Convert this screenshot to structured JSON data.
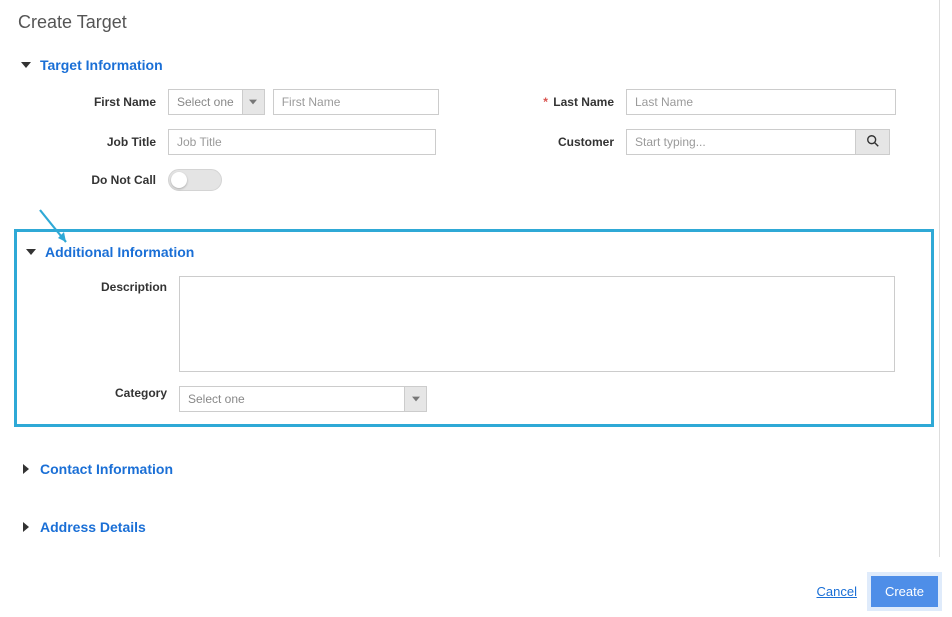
{
  "page": {
    "title": "Create Target"
  },
  "sections": {
    "target_info": {
      "title": "Target Information",
      "fields": {
        "first_name": {
          "label": "First Name",
          "select_placeholder": "Select one",
          "placeholder": "First Name"
        },
        "last_name": {
          "label": "Last Name",
          "placeholder": "Last Name",
          "required_mark": "*"
        },
        "job_title": {
          "label": "Job Title",
          "placeholder": "Job Title"
        },
        "customer": {
          "label": "Customer",
          "placeholder": "Start typing..."
        },
        "do_not_call": {
          "label": "Do Not Call"
        }
      }
    },
    "additional_info": {
      "title": "Additional Information",
      "fields": {
        "description": {
          "label": "Description"
        },
        "category": {
          "label": "Category",
          "select_placeholder": "Select one"
        }
      }
    },
    "contact_info": {
      "title": "Contact Information"
    },
    "address_details": {
      "title": "Address Details"
    }
  },
  "footer": {
    "cancel": "Cancel",
    "create": "Create"
  }
}
